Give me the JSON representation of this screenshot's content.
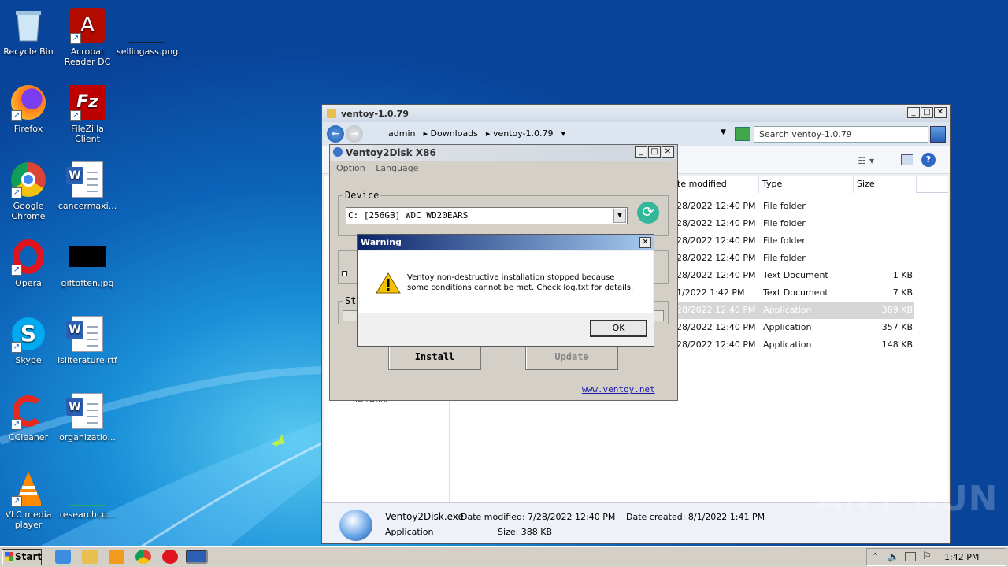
{
  "desktop": {
    "icons": [
      {
        "label": "Recycle Bin",
        "icon": "recycle-bin-icon"
      },
      {
        "label": "Acrobat Reader DC",
        "icon": "acrobat-icon"
      },
      {
        "label": "sellingass.png",
        "icon": "image-file-icon"
      },
      {
        "label": "Firefox",
        "icon": "firefox-icon"
      },
      {
        "label": "FileZilla Client",
        "icon": "filezilla-icon"
      },
      {
        "label": "Google Chrome",
        "icon": "chrome-icon"
      },
      {
        "label": "cancermaxi...",
        "icon": "word-doc-icon"
      },
      {
        "label": "Opera",
        "icon": "opera-icon"
      },
      {
        "label": "giftoften.jpg",
        "icon": "image-file-icon"
      },
      {
        "label": "Skype",
        "icon": "skype-icon"
      },
      {
        "label": "isliterature.rtf",
        "icon": "word-doc-icon"
      },
      {
        "label": "CCleaner",
        "icon": "ccleaner-icon"
      },
      {
        "label": "organizatio...",
        "icon": "word-doc-icon"
      },
      {
        "label": "VLC media player",
        "icon": "vlc-icon"
      },
      {
        "label": "researchcd...",
        "icon": "file-icon"
      }
    ]
  },
  "explorer": {
    "title": "ventoy-1.0.79",
    "breadcrumb": [
      "admin",
      "Downloads",
      "ventoy-1.0.79"
    ],
    "search_placeholder": "Search ventoy-1.0.79",
    "columns": [
      "te modified",
      "Type",
      "Size"
    ],
    "rows": [
      {
        "date": "28/2022 12:40 PM",
        "type": "File folder",
        "size": ""
      },
      {
        "date": "28/2022 12:40 PM",
        "type": "File folder",
        "size": ""
      },
      {
        "date": "28/2022 12:40 PM",
        "type": "File folder",
        "size": ""
      },
      {
        "date": "28/2022 12:40 PM",
        "type": "File folder",
        "size": ""
      },
      {
        "date": "28/2022 12:40 PM",
        "type": "Text Document",
        "size": "1 KB"
      },
      {
        "date": "1/2022 1:42 PM",
        "type": "Text Document",
        "size": "7 KB"
      },
      {
        "date": "28/2022 12:40 PM",
        "type": "Application",
        "size": "389 KB"
      },
      {
        "date": "28/2022 12:40 PM",
        "type": "Application",
        "size": "357 KB"
      },
      {
        "date": "28/2022 12:40 PM",
        "type": "Application",
        "size": "148 KB"
      }
    ],
    "sidebar_fragment": "Network",
    "status": {
      "filename": "Ventoy2Disk.exe",
      "date_modified": "Date modified: 7/28/2022 12:40 PM",
      "date_created": "Date created: 8/1/2022 1:41 PM",
      "filetype": "Application",
      "size": "Size: 388 KB"
    }
  },
  "ventoy": {
    "title": "Ventoy2Disk  X86",
    "menu": [
      "Option",
      "Language"
    ],
    "device_label": "Device",
    "device_value": "C: [256GB]  WDC WD20EARS",
    "status_label": "St",
    "install_label": "Install",
    "update_label": "Update",
    "link": "www.ventoy.net"
  },
  "warning": {
    "title": "Warning",
    "message": "Ventoy non-destructive installation stopped because some conditions cannot be met. Check log.txt for details.",
    "ok_label": "OK"
  },
  "taskbar": {
    "start_label": "Start",
    "clock": "1:42 PM"
  },
  "watermark": "ANY RUN"
}
